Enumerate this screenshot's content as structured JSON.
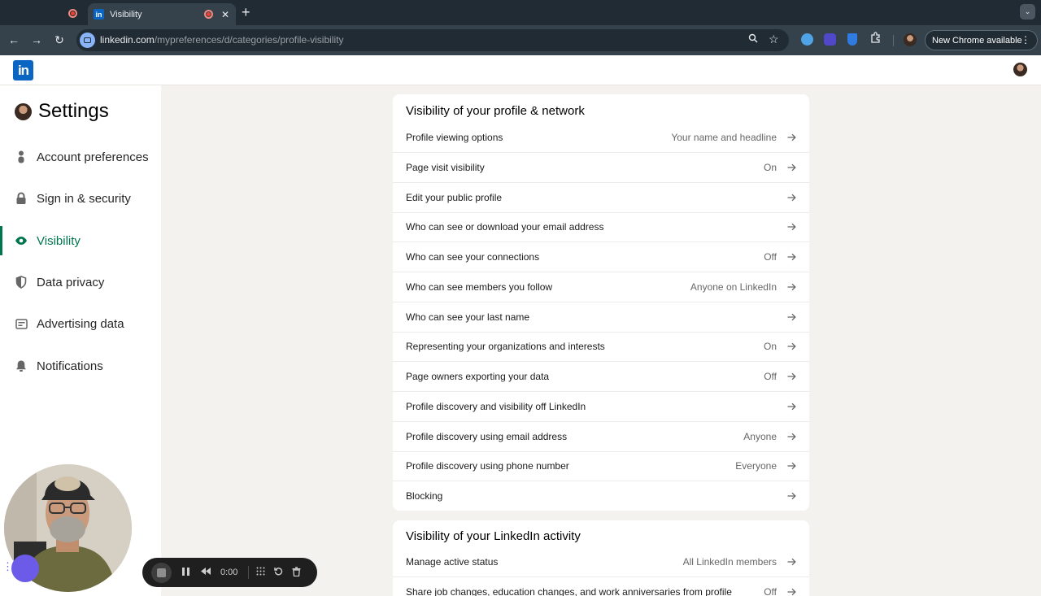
{
  "browser": {
    "active_tab_title": "Visibility",
    "tab_favicon_text": "in",
    "new_tab_glyph": "+",
    "url_domain": "linkedin.com",
    "url_path": "/mypreferences/d/categories/profile-visibility",
    "update_button_label": "New Chrome available",
    "icons": [
      "back-arrow-icon",
      "forward-arrow-icon",
      "reload-icon",
      "zoom-icon",
      "bookmark-star-icon",
      "extensions-puzzle-icon",
      "kebab-menu-icon"
    ]
  },
  "linkedin": {
    "logo_text": "in",
    "brand_color": "#0a66c2",
    "accent_color": "#01754f"
  },
  "sidebar": {
    "title": "Settings",
    "items": [
      {
        "label": "Account preferences",
        "icon": "person-icon"
      },
      {
        "label": "Sign in & security",
        "icon": "lock-icon"
      },
      {
        "label": "Visibility",
        "icon": "eye-icon",
        "active": true
      },
      {
        "label": "Data privacy",
        "icon": "shield-icon"
      },
      {
        "label": "Advertising data",
        "icon": "ad-card-icon"
      },
      {
        "label": "Notifications",
        "icon": "bell-icon"
      }
    ]
  },
  "main": {
    "section1": {
      "title": "Visibility of your profile & network",
      "rows": [
        {
          "label": "Profile viewing options",
          "value": "Your name and headline"
        },
        {
          "label": "Page visit visibility",
          "value": "On"
        },
        {
          "label": "Edit your public profile",
          "value": ""
        },
        {
          "label": "Who can see or download your email address",
          "value": ""
        },
        {
          "label": "Who can see your connections",
          "value": "Off"
        },
        {
          "label": "Who can see members you follow",
          "value": "Anyone on LinkedIn"
        },
        {
          "label": "Who can see your last name",
          "value": ""
        },
        {
          "label": "Representing your organizations and interests",
          "value": "On"
        },
        {
          "label": "Page owners exporting your data",
          "value": "Off"
        },
        {
          "label": "Profile discovery and visibility off LinkedIn",
          "value": ""
        },
        {
          "label": "Profile discovery using email address",
          "value": "Anyone"
        },
        {
          "label": "Profile discovery using phone number",
          "value": "Everyone"
        },
        {
          "label": "Blocking",
          "value": ""
        }
      ]
    },
    "section2": {
      "title": "Visibility of your LinkedIn activity",
      "rows": [
        {
          "label": "Manage active status",
          "value": "All LinkedIn members"
        },
        {
          "label": "Share job changes, education changes, and work anniversaries from profile",
          "value": "Off"
        }
      ]
    }
  },
  "recorder": {
    "time": "0:00",
    "icons": [
      "stop-icon",
      "pause-icon",
      "rewind-icon",
      "grid-icon",
      "restart-icon",
      "trash-icon"
    ]
  }
}
